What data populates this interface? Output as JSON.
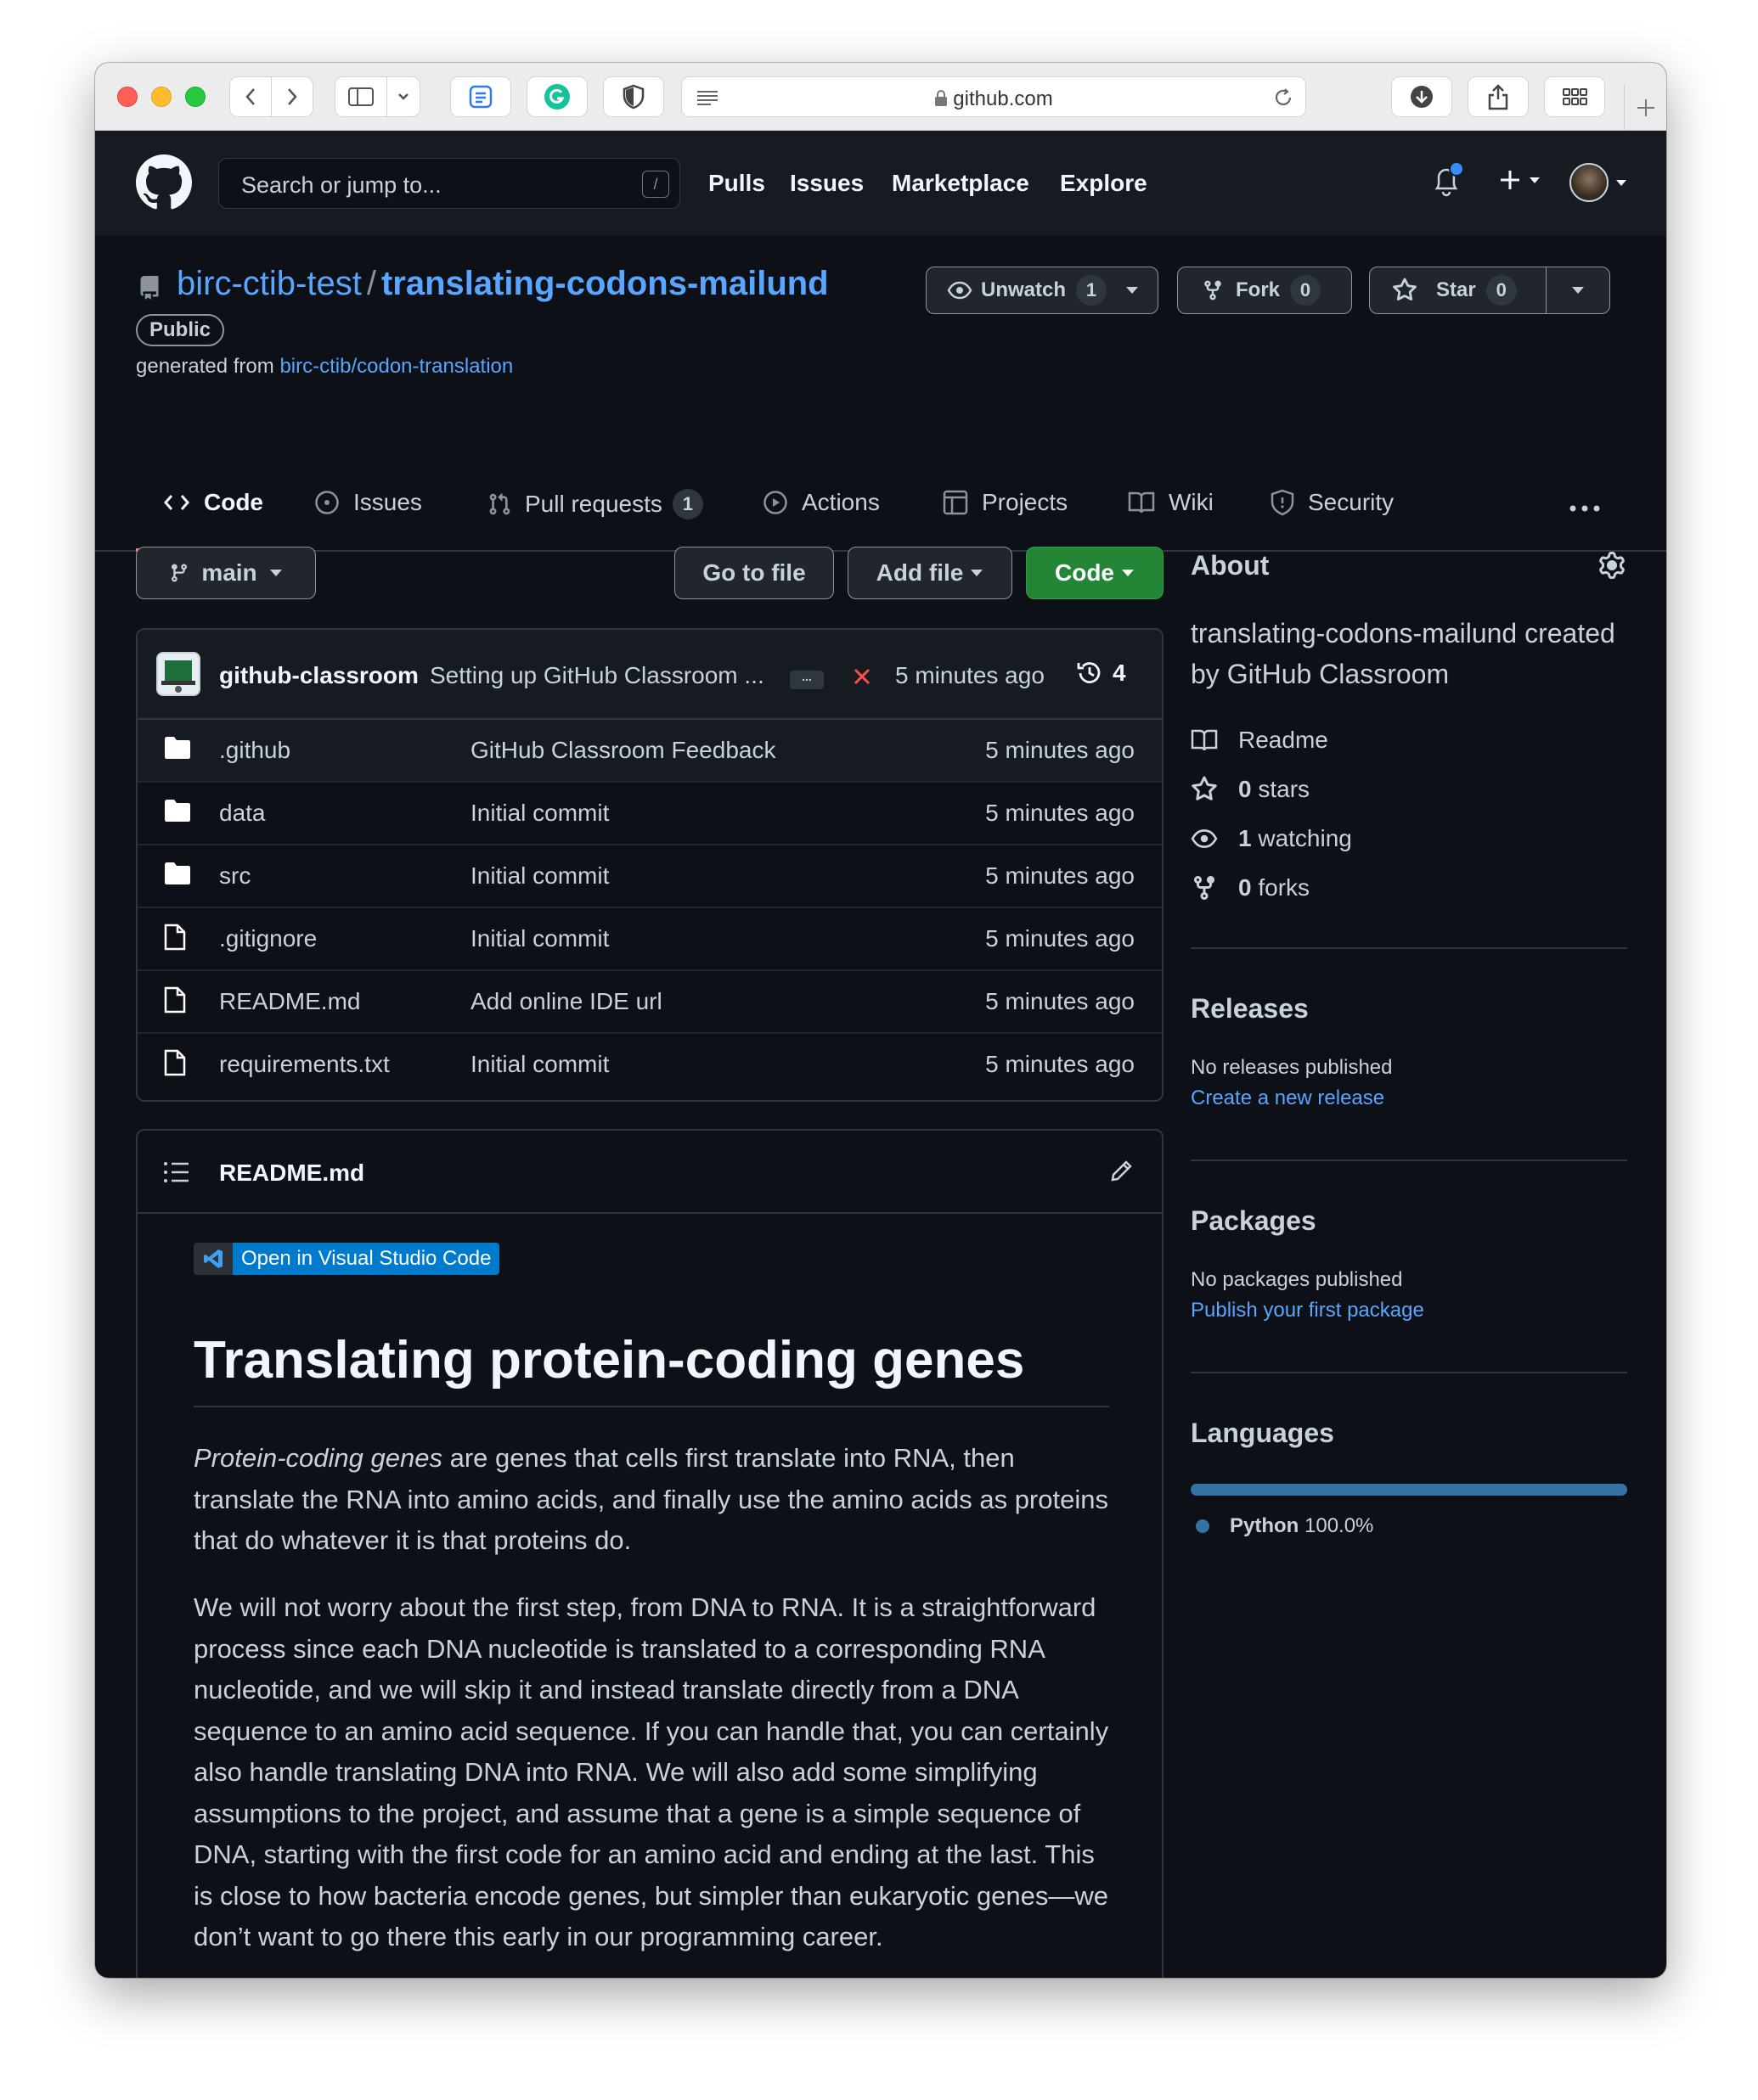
{
  "browser": {
    "url": "github.com"
  },
  "header": {
    "search_placeholder": "Search or jump to...",
    "search_shortcut": "/",
    "nav": [
      "Pulls",
      "Issues",
      "Marketplace",
      "Explore"
    ]
  },
  "repo": {
    "owner": "birc-ctib-test",
    "separator": "/",
    "name": "translating-codons-mailund",
    "visibility": "Public",
    "generated_from_label": "generated from",
    "generated_from_link": "birc-ctib/codon-translation",
    "watch_label": "Unwatch",
    "watch_count": "1",
    "fork_label": "Fork",
    "fork_count": "0",
    "star_label": "Star",
    "star_count": "0"
  },
  "tabs": [
    {
      "label": "Code",
      "selected": true
    },
    {
      "label": "Issues"
    },
    {
      "label": "Pull requests",
      "count": "1"
    },
    {
      "label": "Actions"
    },
    {
      "label": "Projects"
    },
    {
      "label": "Wiki"
    },
    {
      "label": "Security"
    }
  ],
  "toolbar": {
    "branch": "main",
    "go_to_file": "Go to file",
    "add_file": "Add file",
    "code": "Code"
  },
  "commit": {
    "author": "github-classroom",
    "message": "Setting up GitHub Classroom ...",
    "ellipsis": "...",
    "time": "5 minutes ago",
    "history_count": "4"
  },
  "files": [
    {
      "icon": "folder-icon",
      "name": ".github",
      "message": "GitHub Classroom Feedback",
      "time": "5 minutes ago"
    },
    {
      "icon": "folder-icon",
      "name": "data",
      "message": "Initial commit",
      "time": "5 minutes ago"
    },
    {
      "icon": "folder-icon",
      "name": "src",
      "message": "Initial commit",
      "time": "5 minutes ago"
    },
    {
      "icon": "file-icon",
      "name": ".gitignore",
      "message": "Initial commit",
      "time": "5 minutes ago"
    },
    {
      "icon": "file-icon",
      "name": "README.md",
      "message": "Add online IDE url",
      "time": "5 minutes ago"
    },
    {
      "icon": "file-icon",
      "name": "requirements.txt",
      "message": "Initial commit",
      "time": "5 minutes ago"
    }
  ],
  "readme": {
    "filename": "README.md",
    "badge": "Open in Visual Studio Code",
    "heading": "Translating protein-coding genes",
    "para1_em": "Protein-coding genes",
    "para1_rest": " are genes that cells first translate into RNA, then translate the RNA into amino acids, and finally use the amino acids as proteins that do whatever it is that proteins do.",
    "para2": "We will not worry about the first step, from DNA to RNA. It is a straightforward process since each DNA nucleotide is translated to a corresponding RNA nucleotide, and we will skip it and instead translate directly from a DNA sequence to an amino acid sequence. If you can handle that, you can certainly also handle translating DNA into RNA. We will also add some simplifying assumptions to the project, and assume that a gene is a simple sequence of DNA, starting with the first code for an amino acid and ending at the last. This is close to how bacteria encode genes, but simpler than eukaryotic genes—we don’t want to go there this early in our programming career."
  },
  "about": {
    "heading": "About",
    "description": "translating-codons-mailund created by GitHub Classroom",
    "readme": "Readme",
    "stars_num": "0",
    "stars_label": "stars",
    "watching_num": "1",
    "watching_label": "watching",
    "forks_num": "0",
    "forks_label": "forks"
  },
  "releases": {
    "heading": "Releases",
    "none": "No releases published",
    "link": "Create a new release"
  },
  "packages": {
    "heading": "Packages",
    "none": "No packages published",
    "link": "Publish your first package"
  },
  "languages": {
    "heading": "Languages",
    "items": [
      {
        "name": "Python",
        "percent": "100.0%",
        "color": "#3572A5"
      }
    ]
  },
  "colors": {
    "accent_link": "#58a6ff",
    "code_button": "#238636",
    "tab_underline": "#f78166",
    "commit_fail": "#f85149"
  }
}
